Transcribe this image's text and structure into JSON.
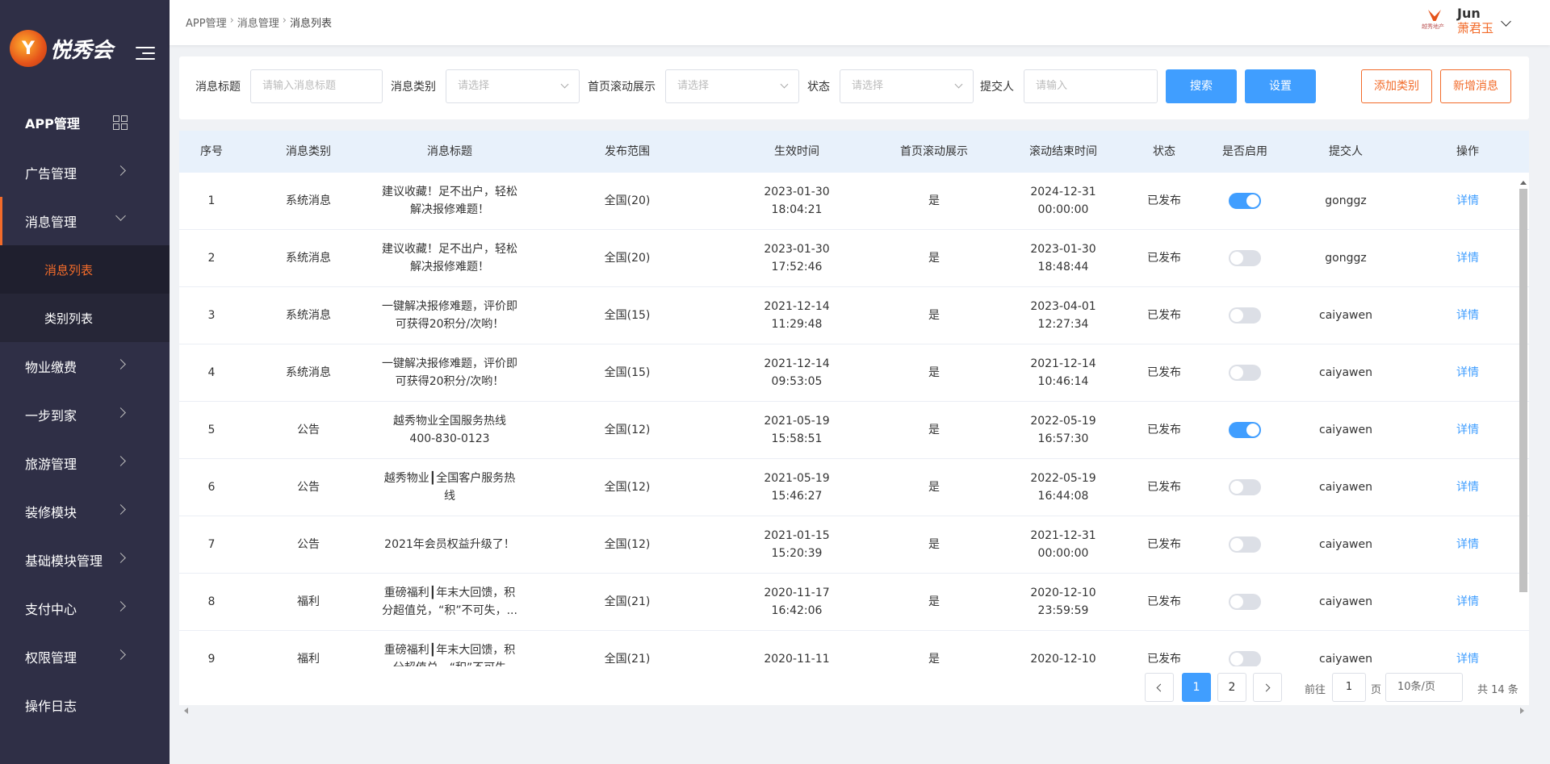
{
  "brand": {
    "logo_glyph": "Y",
    "name": "悦秀会"
  },
  "sidebar": {
    "items": [
      {
        "label": "APP管理"
      },
      {
        "label": "广告管理"
      },
      {
        "label": "消息管理"
      },
      {
        "label": "物业缴费"
      },
      {
        "label": "一步到家"
      },
      {
        "label": "旅游管理"
      },
      {
        "label": "装修模块"
      },
      {
        "label": "基础模块管理"
      },
      {
        "label": "支付中心"
      },
      {
        "label": "权限管理"
      },
      {
        "label": "操作日志"
      }
    ],
    "submenu": [
      {
        "label": "消息列表"
      },
      {
        "label": "类别列表"
      }
    ]
  },
  "header": {
    "breadcrumb": [
      "APP管理",
      "消息管理",
      "消息列表"
    ],
    "user_logo_text": "越秀地产",
    "user_name": "Jun",
    "user_sub": "萧君玉"
  },
  "filter": {
    "title_label": "消息标题",
    "title_placeholder": "请输入消息标题",
    "category_label": "消息类别",
    "category_placeholder": "请选择",
    "scroll_label": "首页滚动展示",
    "scroll_placeholder": "请选择",
    "status_label": "状态",
    "status_placeholder": "请选择",
    "submitter_label": "提交人",
    "submitter_placeholder": "请输入",
    "search_btn": "搜索",
    "settings_btn": "设置",
    "add_category_btn": "添加类别",
    "add_message_btn": "新增消息"
  },
  "table": {
    "columns": [
      "序号",
      "消息类别",
      "消息标题",
      "发布范围",
      "生效时间",
      "首页滚动展示",
      "滚动结束时间",
      "状态",
      "是否启用",
      "提交人",
      "操作"
    ],
    "rows": [
      {
        "no": "1",
        "category": "系统消息",
        "title": "建议收藏！足不出户，轻松解决报修难题！",
        "scope": "全国(20)",
        "eff_date": "2023-01-30",
        "eff_time": "18:04:21",
        "scroll": "是",
        "end_date": "2024-12-31",
        "end_time": "00:00:00",
        "status": "已发布",
        "enabled": true,
        "submitter": "gonggz",
        "action": "详情"
      },
      {
        "no": "2",
        "category": "系统消息",
        "title": "建议收藏！足不出户，轻松解决报修难题！",
        "scope": "全国(20)",
        "eff_date": "2023-01-30",
        "eff_time": "17:52:46",
        "scroll": "是",
        "end_date": "2023-01-30",
        "end_time": "18:48:44",
        "status": "已发布",
        "enabled": false,
        "submitter": "gonggz",
        "action": "详情"
      },
      {
        "no": "3",
        "category": "系统消息",
        "title": "一键解决报修难题，评价即可获得20积分/次哟！",
        "scope": "全国(15)",
        "eff_date": "2021-12-14",
        "eff_time": "11:29:48",
        "scroll": "是",
        "end_date": "2023-04-01",
        "end_time": "12:27:34",
        "status": "已发布",
        "enabled": false,
        "submitter": "caiyawen",
        "action": "详情"
      },
      {
        "no": "4",
        "category": "系统消息",
        "title": "一键解决报修难题，评价即可获得20积分/次哟！",
        "scope": "全国(15)",
        "eff_date": "2021-12-14",
        "eff_time": "09:53:05",
        "scroll": "是",
        "end_date": "2021-12-14",
        "end_time": "10:46:14",
        "status": "已发布",
        "enabled": false,
        "submitter": "caiyawen",
        "action": "详情"
      },
      {
        "no": "5",
        "category": "公告",
        "title": "越秀物业全国服务热线400-830-0123",
        "scope": "全国(12)",
        "eff_date": "2021-05-19",
        "eff_time": "15:58:51",
        "scroll": "是",
        "end_date": "2022-05-19",
        "end_time": "16:57:30",
        "status": "已发布",
        "enabled": true,
        "submitter": "caiyawen",
        "action": "详情"
      },
      {
        "no": "6",
        "category": "公告",
        "title": "越秀物业┃全国客户服务热线",
        "scope": "全国(12)",
        "eff_date": "2021-05-19",
        "eff_time": "15:46:27",
        "scroll": "是",
        "end_date": "2022-05-19",
        "end_time": "16:44:08",
        "status": "已发布",
        "enabled": false,
        "submitter": "caiyawen",
        "action": "详情"
      },
      {
        "no": "7",
        "category": "公告",
        "title": "2021年会员权益升级了！",
        "scope": "全国(12)",
        "eff_date": "2021-01-15",
        "eff_time": "15:20:39",
        "scroll": "是",
        "end_date": "2021-12-31",
        "end_time": "00:00:00",
        "status": "已发布",
        "enabled": false,
        "submitter": "caiyawen",
        "action": "详情"
      },
      {
        "no": "8",
        "category": "福利",
        "title": "重磅福利┃年末大回馈，积分超值兑，“积”不可失，...",
        "scope": "全国(21)",
        "eff_date": "2020-11-17",
        "eff_time": "16:42:06",
        "scroll": "是",
        "end_date": "2020-12-10",
        "end_time": "23:59:59",
        "status": "已发布",
        "enabled": false,
        "submitter": "caiyawen",
        "action": "详情"
      },
      {
        "no": "9",
        "category": "福利",
        "title": "重磅福利┃年末大回馈，积分超值兑，“积”不可失",
        "scope": "全国(21)",
        "eff_date": "2020-11-11",
        "eff_time": "",
        "scroll": "是",
        "end_date": "2020-12-10",
        "end_time": "",
        "status": "已发布",
        "enabled": false,
        "submitter": "caiyawen",
        "action": "详情"
      }
    ]
  },
  "pagination": {
    "pages": [
      "1",
      "2"
    ],
    "current": "1",
    "goto_prefix": "前往",
    "goto_value": "1",
    "goto_suffix": "页",
    "page_size": "10条/页",
    "total": "共 14 条"
  },
  "colors": {
    "accent": "#f26b2a",
    "primary": "#409eff",
    "sidebar_bg": "#2f2f46"
  }
}
